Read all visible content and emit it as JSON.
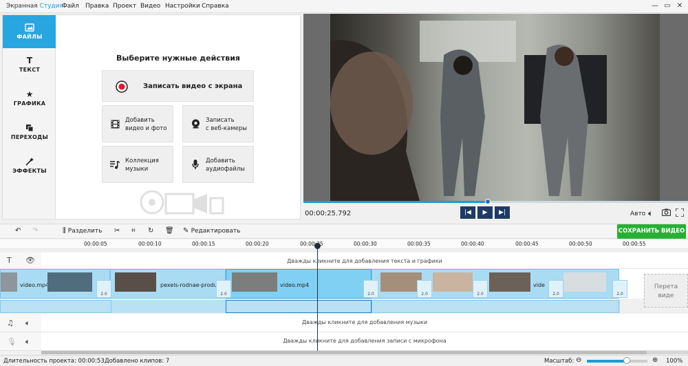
{
  "app": {
    "title_main": "Экранная ",
    "title_accent": "Студия"
  },
  "menu": [
    "Файл",
    "Правка",
    "Проект",
    "Видео",
    "Настройки",
    "Справка"
  ],
  "window_controls": {
    "minimize": "—",
    "maximize": "▭",
    "close": "✕"
  },
  "sidebar": {
    "items": [
      {
        "label": "ФАЙЛЫ",
        "icon": "files-icon",
        "active": true
      },
      {
        "label": "ТЕКСТ",
        "icon": "text-icon",
        "active": false
      },
      {
        "label": "ГРАФИКА",
        "icon": "star-icon",
        "active": false
      },
      {
        "label": "ПЕРЕХОДЫ",
        "icon": "transitions-icon",
        "active": false
      },
      {
        "label": "ЭФФЕКТЫ",
        "icon": "magic-wand-icon",
        "active": false
      }
    ]
  },
  "actions": {
    "title": "Выберите нужные действия",
    "record_screen": "Записать видео с экрана",
    "add_video_line1": "Добавить",
    "add_video_line2": "видео и фото",
    "webcam_line1": "Записать",
    "webcam_line2": "с веб-камеры",
    "music_line1": "Коллекция",
    "music_line2": "музыки",
    "audio_line1": "Добавить",
    "audio_line2": "аудиофайлы"
  },
  "player": {
    "current_time": "00:00:25.792",
    "progress": 0.48,
    "quality": "Авто"
  },
  "toolbar": {
    "split": "Разделить",
    "edit": "Редактировать",
    "save": "СОХРАНИТЬ ВИДЕО"
  },
  "ruler": {
    "ticks": [
      "00:00:05",
      "00:00:10",
      "00:00:15",
      "00:00:20",
      "00:00:25",
      "00:00:30",
      "00:00:35",
      "00:00:40",
      "00:00:45",
      "00:00:50",
      "00:00:55"
    ]
  },
  "timeline": {
    "text_hint": "Дважды кликните для добавления текста и графики",
    "music_hint": "Дважды кликните для добавления музыки",
    "mic_hint": "Дважды кликните для добавления записи с микрофона",
    "clips": [
      {
        "name": "video.mp4"
      },
      {
        "name": "pexels-rodnae-product"
      },
      {
        "name": "video.mp4"
      },
      {
        "name": "vide"
      }
    ],
    "transition_duration": "2.0",
    "drop_zone_line1": "Перета",
    "drop_zone_line2": "виде"
  },
  "status": {
    "duration": "Длительность проекта: 00:00:53",
    "clips_added": "Добавлено клипов: 7",
    "zoom_label": "Масштаб:",
    "zoom_value": "100%",
    "zoom_level": 0.66
  },
  "colors": {
    "accent": "#28a6e0",
    "save": "#27b033",
    "playhead": "#1d2d44"
  }
}
